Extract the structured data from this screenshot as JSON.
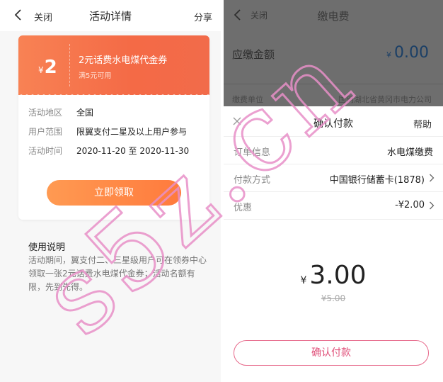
{
  "left": {
    "nav": {
      "close": "关闭",
      "title": "活动详情",
      "share": "分享"
    },
    "coupon": {
      "currency": "¥",
      "amount": "2",
      "title": "2元话费水电煤代金券",
      "condition": "满5元可用"
    },
    "info": [
      {
        "key": "活动地区",
        "value": "全国"
      },
      {
        "key": "用户范围",
        "value": "限翼支付二星及以上用户参与"
      },
      {
        "key": "活动时间",
        "value": "2020-11-20 至 2020-11-30"
      }
    ],
    "claim_button": "立即领取",
    "usage": {
      "title": "使用说明",
      "text": "活动期间，翼支付二、三星级用户可在领券中心领取一张2元话费水电煤代金券；活动名额有限，先到先得。"
    }
  },
  "right": {
    "nav": {
      "close": "关闭",
      "title": "缴电费"
    },
    "amount_label": "应缴金额",
    "amount_currency": "¥",
    "amount_value": "0.00",
    "unit_label": "缴费单位",
    "unit_value": "国网湖北省黄冈市电力公司",
    "sheet": {
      "title": "确认付款",
      "help": "帮助",
      "rows": [
        {
          "key": "订单信息",
          "value": "水电煤缴费"
        },
        {
          "key": "付款方式",
          "value": "中国银行储蓄卡(1878)"
        },
        {
          "key": "优惠",
          "value": "-¥2.00"
        }
      ],
      "pay_currency": "¥",
      "pay_amount": "3.00",
      "original_amount": "¥5.00",
      "confirm_button": "确认付款"
    }
  },
  "watermark": {
    "text": "s5z.cn",
    "color": "#e890c8"
  },
  "colors": {
    "coupon_orange": "#f46a46",
    "button_orange": "#ff7a3d",
    "confirm_pink": "#e0507a",
    "dim_overlay": "#6e6e6e"
  }
}
